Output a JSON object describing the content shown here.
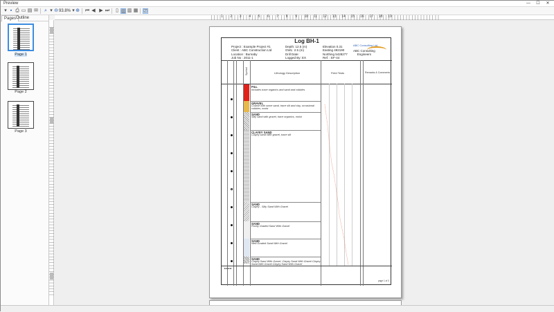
{
  "window": {
    "title": "Preview",
    "minimize": "—",
    "maximize": "☐",
    "close": "✕"
  },
  "toolbar": {
    "zoom": "93.8%"
  },
  "left_panel": {
    "tabs": [
      "Pages",
      "Outline"
    ],
    "pages": [
      "Page 1",
      "Page 2",
      "Page 3"
    ]
  },
  "ruler": {
    "numbers": [
      "1",
      "2",
      "3",
      "4",
      "5",
      "6",
      "7",
      "8",
      "9",
      "10",
      "11",
      "12",
      "13",
      "14",
      "15",
      "16",
      "17",
      "18",
      "19"
    ]
  },
  "log": {
    "title": "Log BH-1",
    "project": "Project : Example Project #1",
    "client": "Client : ABC Construction Ltd",
    "location": "Location : Burnaby",
    "job_no": "Job No : 2011-1",
    "depth": "Depth: 12.5  (m)",
    "gwl": "GWL: 2.5  (m)",
    "drill_date": "Drill Date:",
    "logged_by": "Logged By: EX",
    "elevation": "Elevation 0.31",
    "easting": "Easting 492190",
    "northing": "Northing 5428277",
    "ref": "Ref. : EF-44",
    "company_small": "ABC Consulting Ltd.",
    "company_line1": "ABC Consulting",
    "company_line2": "Engineers",
    "column_headers": {
      "lithology": "Lithology Description",
      "field_tests": "Field Tests",
      "remarks": "Remarks & Comments",
      "symbol": "Symbol"
    },
    "layers": [
      {
        "title": "FILL",
        "desc": "Includes trace organics and sand and cobbles"
      },
      {
        "title": "GRAVEL",
        "desc": "Coarse with some sand, trace silt and clay, occasional"
      },
      {
        "title": "",
        "desc": "cobbles, moist"
      },
      {
        "title": "SAND",
        "desc": "Silty sand with gravel, trace organics, moist"
      },
      {
        "title": "CLAYEY SAND",
        "desc": "Clayey sand With gravel, trace silt"
      },
      {
        "title": "SAND",
        "desc": "Clayey - Silty Sand With Gravel"
      },
      {
        "title": "SAND",
        "desc": "Poorly Graded Sand With Gravel"
      },
      {
        "title": "SAND",
        "desc": "Well Graded Sand With Gravel"
      },
      {
        "title": "SAND",
        "desc": "Clayey Sand With Gravel, Clayey Sand With Gravel Clayey"
      },
      {
        "title": "",
        "desc": "Sand With Gravel Clayey Sand With Gravel"
      }
    ],
    "page_footer": "page 1 of 3"
  },
  "colors": {
    "fill": "#e0221b",
    "gravel": "#e8b84a",
    "selection": "#3c8ce0"
  }
}
